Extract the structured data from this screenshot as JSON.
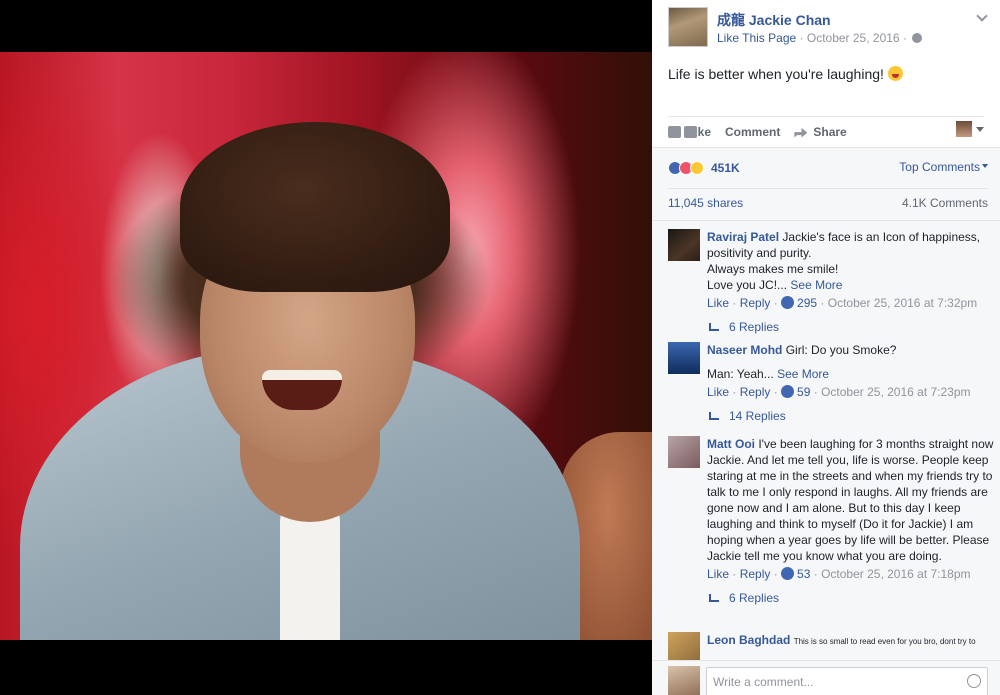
{
  "post": {
    "page_name": "成龍 Jackie Chan",
    "like_page": "Like This Page",
    "date": "October 25, 2016",
    "separator": "·",
    "text": "Life is better when you're laughing!",
    "emoji": "laughing-face-emoji"
  },
  "actions": {
    "like": "Like",
    "comment": "Comment",
    "share": "Share"
  },
  "stats": {
    "reactions_count": "451K",
    "top_comments": "Top Comments",
    "shares": "11,045 shares",
    "comments": "4.1K Comments"
  },
  "comments": [
    {
      "author": "Raviraj Patel",
      "lines": [
        "Jackie's face is an Icon of happiness, positivity and purity.",
        "Always makes me smile!",
        "Love you JC!..."
      ],
      "see_more": "See More",
      "like": "Like",
      "reply": "Reply",
      "likes": "295",
      "time": "October 25, 2016 at 7:32pm",
      "replies": "6 Replies"
    },
    {
      "author": "Naseer Mohd",
      "lines": [
        "Girl: Do you Smoke?",
        "Man: Yeah..."
      ],
      "see_more": "See More",
      "like": "Like",
      "reply": "Reply",
      "likes": "59",
      "time": "October 25, 2016 at 7:23pm",
      "replies": "14 Replies"
    },
    {
      "author": "Matt Ooi",
      "lines": [
        "I've been laughing for 3 months straight now Jackie. And let me tell you, life is worse. People keep staring at me in the streets and when my friends try to talk to me I only respond in laughs. All my friends are gone now and I am alone. But to this day I keep laughing and think to myself (Do it for Jackie) I am hoping when a year goes by life will be better. Please Jackie tell me you know what you are doing."
      ],
      "like": "Like",
      "reply": "Reply",
      "likes": "53",
      "time": "October 25, 2016 at 7:18pm",
      "replies": "6 Replies"
    },
    {
      "author": "Leon Baghdad",
      "lines": [
        "This is so small to read even for you bro, dont try to"
      ]
    }
  ],
  "composer": {
    "placeholder": "Write a comment..."
  },
  "colors": {
    "link": "#365899",
    "muted": "#90949c",
    "panel_bg": "#f6f7f9"
  }
}
